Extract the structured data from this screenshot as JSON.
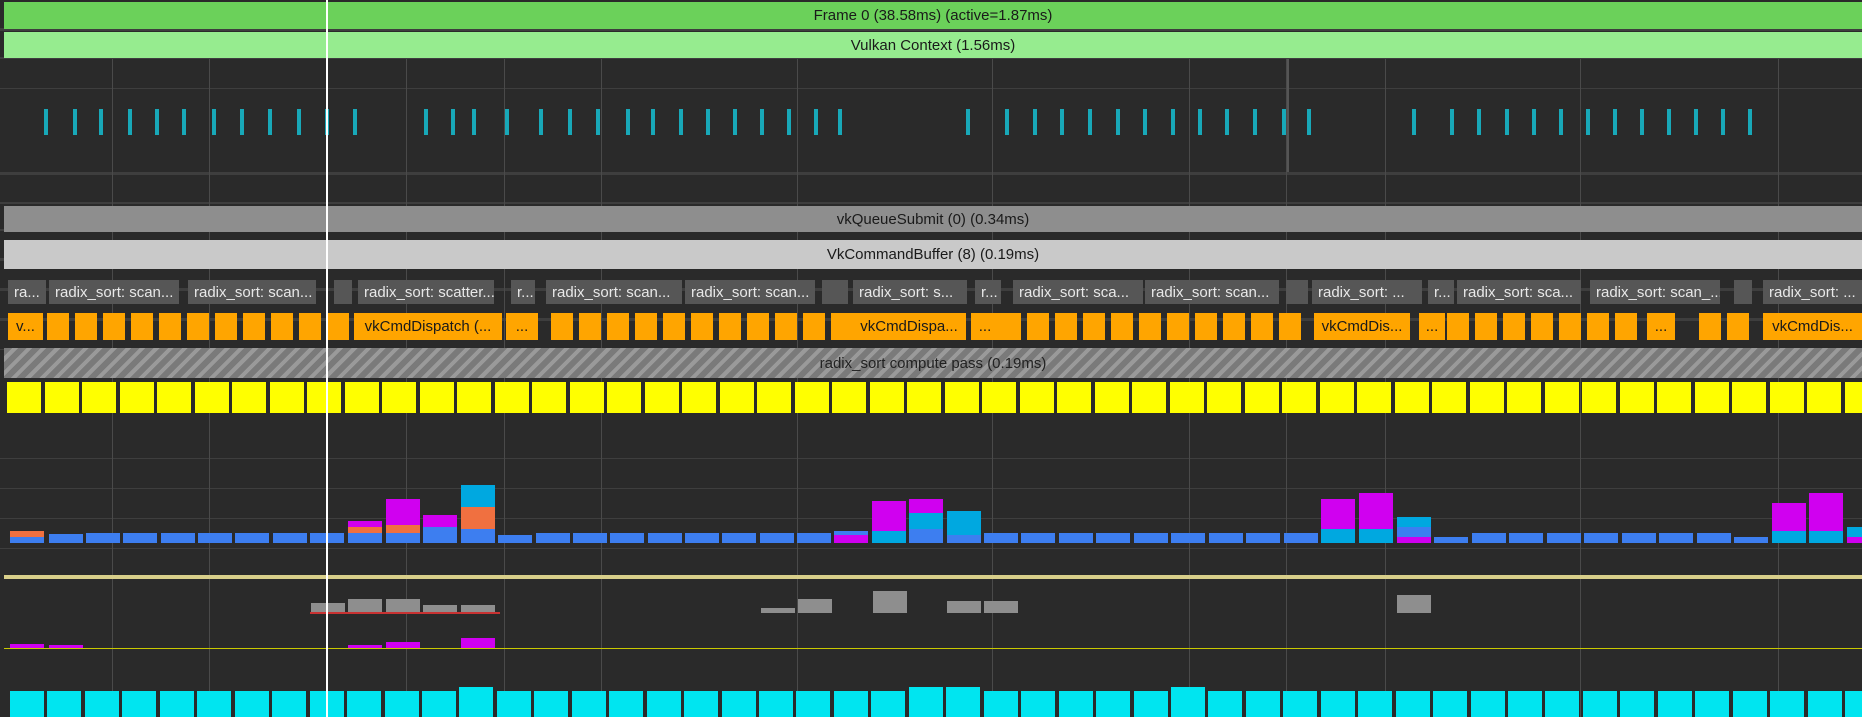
{
  "rows": {
    "frame": {
      "label": "Frame 0 (38.58ms) (active=1.87ms)",
      "color": "#6bd15a"
    },
    "context": {
      "label": "Vulkan Context (1.56ms)",
      "color": "#96ec8f"
    },
    "submit": {
      "label": "vkQueueSubmit (0) (0.34ms)",
      "color": "#8e8e8e"
    },
    "cmdbuf": {
      "label": "VkCommandBuffer (8) (0.19ms)",
      "color": "#c9c9c9"
    },
    "pass": {
      "label": "radix_sort compute pass (0.19ms)",
      "color": "#8a8a8a"
    }
  },
  "markers": [
    {
      "text": "ra..."
    },
    {
      "text": "radix_sort: scan..."
    },
    {
      "text": "radix_sort: scan..."
    },
    {
      "text": ""
    },
    {
      "text": "radix_sort: scatter..."
    },
    {
      "text": "r..."
    },
    {
      "text": "radix_sort: scan..."
    },
    {
      "text": "radix_sort: scan..."
    },
    {
      "text": ""
    },
    {
      "text": "radix_sort: s..."
    },
    {
      "text": "r..."
    },
    {
      "text": "radix_sort: sca..."
    },
    {
      "text": "radix_sort: scan..."
    },
    {
      "text": ""
    },
    {
      "text": "radix_sort: ..."
    },
    {
      "text": "r..."
    },
    {
      "text": "radix_sort: sca..."
    },
    {
      "text": "radix_sort: scan_..."
    },
    {
      "text": ""
    },
    {
      "text": "radix_sort: ..."
    }
  ],
  "dispatch_labels": [
    {
      "text": "v..."
    },
    {
      "text": "vkCmdDispatch (..."
    },
    {
      "text": "..."
    },
    {
      "text": "vkCmdDispa..."
    },
    {
      "text": "..."
    },
    {
      "text": "vkCmdDis..."
    },
    {
      "text": "..."
    },
    {
      "text": "..."
    },
    {
      "text": "vkCmdDis..."
    }
  ],
  "colors": {
    "teal": "#18a8b8",
    "orange": "#ffa500",
    "yellow": "#ffff00",
    "cyan": "#00e5f0",
    "magenta": "#d000f0",
    "sky": "#00a8e0",
    "blue": "#3d7ef0",
    "coral": "#f07040",
    "grey": "#8a8a8a",
    "khaki": "#d8cf8a"
  }
}
